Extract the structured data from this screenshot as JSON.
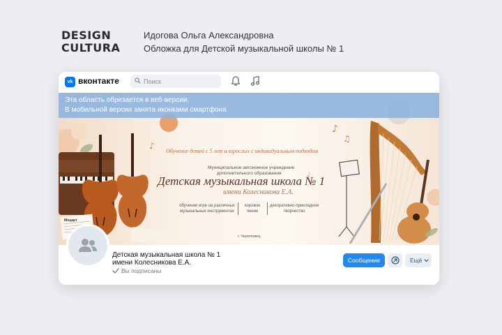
{
  "header": {
    "brand_line1": "DESIGN",
    "brand_line2": "CULTURA",
    "author": "Идогова Ольга Александровна",
    "project": "Обложка для Детской музыкальной школы № 1"
  },
  "vk": {
    "brand": "вконтакте",
    "logo_text": "vk",
    "search_placeholder": "Поиск",
    "icons": [
      "search-icon",
      "bell-icon",
      "music-icon"
    ],
    "accent_color": "#0077ff"
  },
  "cover": {
    "crop_note_line1": "Эта область обрезается в веб-версии.",
    "crop_note_line2": "В мобильной версии занята иконками смартфона",
    "tagline": "Обучение детей с 5 лет и взрослых с индивидуальным подходом",
    "institution_line1": "Муниципальное автономное учреждение",
    "institution_line2": "дополнительного образования",
    "school_name": "Детская музыкальная школа № 1",
    "named_after": "имени Колесникова Е.А.",
    "directions": [
      {
        "line1": "обучение игре на различных",
        "line2": "музыкальных инструментах"
      },
      {
        "line1": "хоровое",
        "line2": "пение"
      },
      {
        "line1": "декоративно-прикладное",
        "line2": "творчество"
      }
    ],
    "city": "г. Череповец",
    "sheet_label": "Моцарт"
  },
  "profile": {
    "name_line1": "Детская музыкальная школа № 1",
    "name_line2": "имени Колесникова Е.А.",
    "subscribed": "Вы подписаны",
    "message_button": "Сообщение",
    "more_button": "Ещё",
    "button_color": "#2688eb"
  }
}
